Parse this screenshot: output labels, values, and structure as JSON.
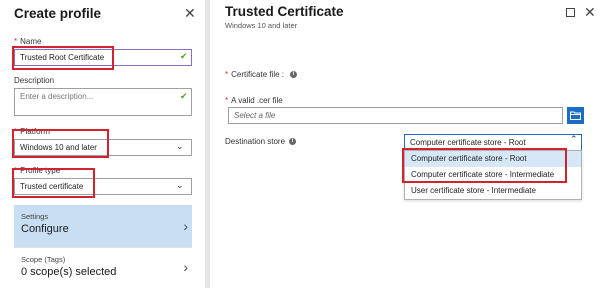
{
  "left_panel": {
    "title": "Create profile",
    "name": {
      "label": "Name",
      "value": "Trusted Root Certificate"
    },
    "description": {
      "label": "Description",
      "placeholder": "Enter a description..."
    },
    "platform": {
      "label": "Platform",
      "value": "Windows 10 and later"
    },
    "profile_type": {
      "label": "Profile type",
      "value": "Trusted certificate"
    },
    "nav": [
      {
        "small": "Settings",
        "big": "Configure"
      },
      {
        "small": "Scope (Tags)",
        "big": "0 scope(s) selected"
      }
    ]
  },
  "right_panel": {
    "title": "Trusted Certificate",
    "subtitle": "Windows 10 and later",
    "certificate_file_label": "Certificate file :",
    "cer_file": {
      "label": "A valid .cer file",
      "placeholder": "Select a file"
    },
    "destination_store": {
      "label": "Destination store",
      "value": "Computer certificate store - Root",
      "options": [
        "Computer certificate store - Root",
        "Computer certificate store - Intermediate",
        "User certificate store - Intermediate"
      ],
      "selected_index": 0
    }
  },
  "colors": {
    "accent": "#1a6dc2",
    "highlight_box": "#d3232f",
    "active_nav": "#c8dff3",
    "valid_check": "#5a9b2a"
  }
}
